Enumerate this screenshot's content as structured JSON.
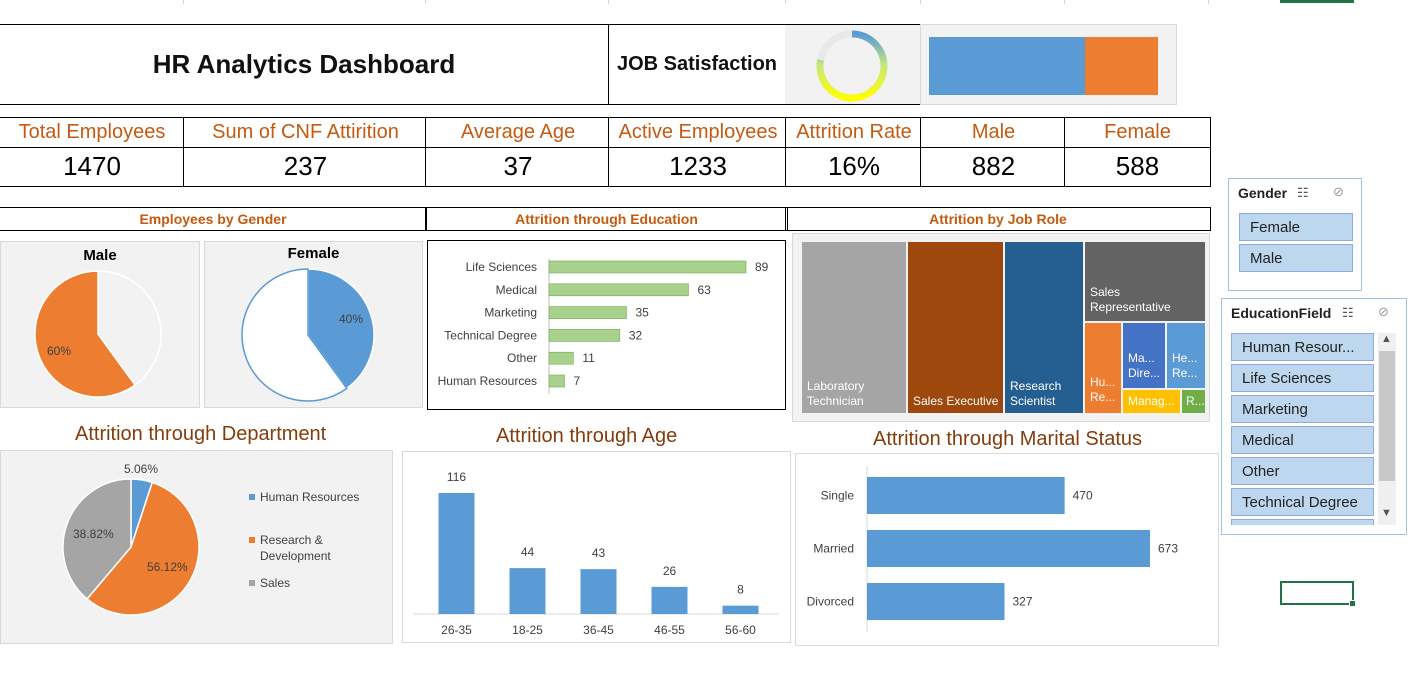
{
  "header": {
    "title": "HR Analytics Dashboard",
    "job_satisfaction_label": "JOB Satisfaction"
  },
  "job_satisfaction": {
    "gauge_fraction": 0.78,
    "bar_fraction_blue": 0.68
  },
  "kpis": [
    {
      "label": "Total Employees",
      "value": "1470"
    },
    {
      "label": "Sum of CNF Attirition",
      "value": "237"
    },
    {
      "label": "Average Age",
      "value": "37"
    },
    {
      "label": "Active Employees",
      "value": "1233"
    },
    {
      "label": "Attrition Rate",
      "value": "16%"
    },
    {
      "label": "Male",
      "value": "882"
    },
    {
      "label": "Female",
      "value": "588"
    }
  ],
  "sections": {
    "gender": "Employees by Gender",
    "education": "Attrition through Education",
    "job_role": "Attrition by Job Role"
  },
  "gender_charts": {
    "male_title": "Male",
    "male_pct_label": "60%",
    "female_title": "Female",
    "female_pct_label": "40%"
  },
  "titles": {
    "department": "Attrition through Department",
    "age": "Attrition through Age",
    "marital": "Attrition through Marital Status"
  },
  "chart_data": [
    {
      "type": "pie",
      "title": "Male",
      "slices": [
        {
          "label": "60%",
          "value": 60,
          "color": "#ed7d31"
        },
        {
          "label": "",
          "value": 40,
          "color": "#f2f2f2"
        }
      ]
    },
    {
      "type": "pie",
      "title": "Female",
      "slices": [
        {
          "label": "40%",
          "value": 40,
          "color": "#5b9bd5"
        },
        {
          "label": "",
          "value": 60,
          "color": "#ffffff"
        }
      ]
    },
    {
      "type": "bar",
      "orientation": "horizontal",
      "title": "Attrition through Education",
      "categories": [
        "Life Sciences",
        "Medical",
        "Marketing",
        "Technical Degree",
        "Other",
        "Human Resources"
      ],
      "values": [
        89,
        63,
        35,
        32,
        11,
        7
      ],
      "color": "#a9d18e"
    },
    {
      "type": "treemap",
      "title": "Attrition by Job Role",
      "items": [
        {
          "label": "Laboratory Technician",
          "color": "#a5a5a5"
        },
        {
          "label": "Sales Executive",
          "color": "#9e480e"
        },
        {
          "label": "Research Scientist",
          "color": "#255e91"
        },
        {
          "label": "Sales Representative",
          "color": "#636363"
        },
        {
          "label": "Hu... Re...",
          "color": "#ed7d31"
        },
        {
          "label": "Ma... Dire...",
          "color": "#4472c4"
        },
        {
          "label": "He... Re...",
          "color": "#5b9bd5"
        },
        {
          "label": "Manag...",
          "color": "#ffc000"
        },
        {
          "label": "R...",
          "color": "#70ad47"
        }
      ]
    },
    {
      "type": "pie",
      "title": "Attrition through Department",
      "slices": [
        {
          "label": "Human Resources",
          "value": 5.06,
          "display": "5.06%",
          "color": "#5b9bd5"
        },
        {
          "label": "Research & Development",
          "value": 56.12,
          "display": "56.12%",
          "color": "#ed7d31"
        },
        {
          "label": "Sales",
          "value": 38.82,
          "display": "38.82%",
          "color": "#a5a5a5"
        }
      ],
      "legend": "right"
    },
    {
      "type": "bar",
      "title": "Attrition through Age",
      "categories": [
        "26-35",
        "18-25",
        "36-45",
        "46-55",
        "56-60"
      ],
      "values": [
        116,
        44,
        43,
        26,
        8
      ],
      "color": "#5b9bd5"
    },
    {
      "type": "bar",
      "orientation": "horizontal",
      "title": "Attrition through Marital Status",
      "categories": [
        "Single",
        "Married",
        "Divorced"
      ],
      "values": [
        470,
        673,
        327
      ],
      "color": "#5b9bd5"
    }
  ],
  "slicers": {
    "gender": {
      "title": "Gender",
      "items": [
        "Female",
        "Male"
      ]
    },
    "education": {
      "title": "EducationField",
      "items": [
        "Human Resour...",
        "Life Sciences",
        "Marketing",
        "Medical",
        "Other",
        "Technical Degree"
      ]
    }
  }
}
